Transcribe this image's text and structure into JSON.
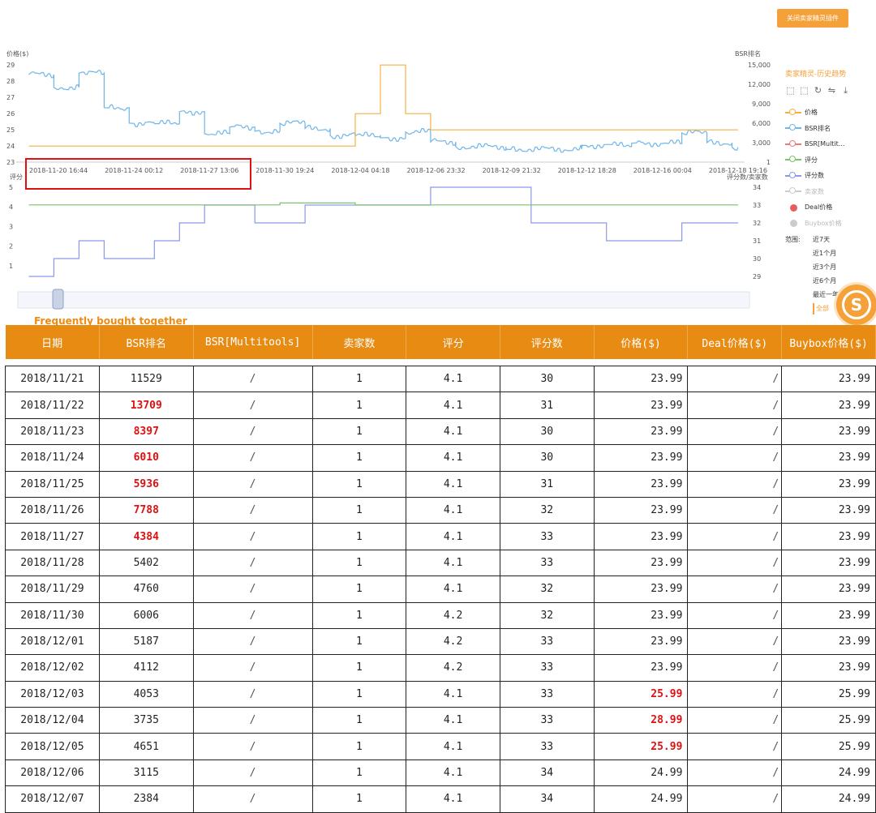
{
  "close_button": "关闭卖家精灵插件",
  "chart_data": [
    {
      "type": "line",
      "yaxis_left": {
        "label": "价格($)",
        "ticks": [
          "23",
          "24",
          "25",
          "26",
          "27",
          "28",
          "29"
        ],
        "range": [
          23,
          29
        ]
      },
      "yaxis_right": {
        "label": "BSR排名",
        "ticks": [
          "1",
          "3,000",
          "6,000",
          "9,000",
          "12,000",
          "15,000"
        ],
        "range": [
          1,
          15000
        ]
      },
      "x_ticks": [
        "2018-11-20 16:44",
        "2018-11-24 00:12",
        "2018-11-27 13:06",
        "2018-11-30 19:24",
        "2018-12-04 04:18",
        "2018-12-06 23:32",
        "2018-12-09 21:32",
        "2018-12-12 18:28",
        "2018-12-16 00:04",
        "2018-12-18 19:16"
      ],
      "series": [
        {
          "name": "价格",
          "color": "#f5b041",
          "x": [
            "2018-11-20",
            "2018-12-03",
            "2018-12-04",
            "2018-12-05",
            "2018-12-06",
            "2018-12-18"
          ],
          "values": [
            23.99,
            25.99,
            28.99,
            25.99,
            24.99,
            24.99
          ]
        },
        {
          "name": "BSR排名",
          "color": "#6fb6e8",
          "x": [
            "2018-11-20",
            "2018-11-21",
            "2018-11-22",
            "2018-11-23",
            "2018-11-24",
            "2018-11-25",
            "2018-11-26",
            "2018-11-27",
            "2018-11-28",
            "2018-11-29",
            "2018-11-30",
            "2018-12-01",
            "2018-12-02",
            "2018-12-03",
            "2018-12-04",
            "2018-12-05",
            "2018-12-06",
            "2018-12-07",
            "2018-12-09",
            "2018-12-12",
            "2018-12-14",
            "2018-12-16",
            "2018-12-17",
            "2018-12-18"
          ],
          "values": [
            13500,
            11529,
            13709,
            8397,
            6010,
            5936,
            7788,
            4384,
            5402,
            4760,
            6006,
            5187,
            4112,
            4053,
            3735,
            4651,
            3115,
            2384,
            2000,
            2600,
            2900,
            4500,
            3000,
            2300
          ]
        }
      ]
    },
    {
      "type": "line",
      "yaxis_left": {
        "label": "评分",
        "ticks": [
          "1",
          "2",
          "3",
          "4",
          "5"
        ],
        "range": [
          0,
          5
        ]
      },
      "yaxis_right": {
        "label": "评分数/卖家数",
        "ticks": [
          "29",
          "30",
          "31",
          "32",
          "33",
          "34"
        ],
        "range": [
          28.5,
          34
        ]
      },
      "series": [
        {
          "name": "评分",
          "color": "#7cc46b",
          "x": [
            "2018-11-20",
            "2018-11-30",
            "2018-12-03",
            "2018-12-18"
          ],
          "values": [
            4.1,
            4.2,
            4.1,
            4.1
          ]
        },
        {
          "name": "评分数",
          "color": "#8a9ae8",
          "x": [
            "2018-11-20",
            "2018-11-21",
            "2018-11-22",
            "2018-11-23",
            "2018-11-25",
            "2018-11-26",
            "2018-11-27",
            "2018-11-28",
            "2018-11-29",
            "2018-11-30",
            "2018-12-01",
            "2018-12-02",
            "2018-12-03",
            "2018-12-06",
            "2018-12-10",
            "2018-12-12",
            "2018-12-13",
            "2018-12-16",
            "2018-12-18"
          ],
          "values": [
            29,
            30,
            31,
            30,
            31,
            32,
            33,
            33,
            32,
            32,
            33,
            33,
            33,
            34,
            32,
            32,
            31,
            32,
            32
          ]
        }
      ]
    }
  ],
  "legend": {
    "title": "卖家精灵-历史趋势",
    "items": [
      {
        "label": "价格",
        "color": "#f5b041",
        "style": "line"
      },
      {
        "label": "BSR排名",
        "color": "#6fb6e8",
        "style": "line"
      },
      {
        "label": "BSR[Multit...",
        "color": "#e87c7c",
        "style": "line"
      },
      {
        "label": "评分",
        "color": "#7cc46b",
        "style": "line"
      },
      {
        "label": "评分数",
        "color": "#8a9ae8",
        "style": "line"
      },
      {
        "label": "卖家数",
        "color": "#cccccc",
        "style": "line"
      },
      {
        "label": "Deal价格",
        "color": "#e85c5c",
        "style": "dot"
      },
      {
        "label": "Buybox价格",
        "color": "#cccccc",
        "style": "dot"
      }
    ],
    "range_label": "范围:",
    "range_options": [
      "近7天",
      "近1个月",
      "近3个月",
      "近6个月",
      "最近一年",
      "全部"
    ]
  },
  "frequently_bought": "Frequently bought together",
  "table": {
    "headers": [
      "日期",
      "BSR排名",
      "BSR[Multitools]",
      "卖家数",
      "评分",
      "评分数",
      "价格($)",
      "Deal价格($)",
      "Buybox价格($)"
    ],
    "rows": [
      {
        "date": "2018/11/21",
        "bsr": "11529",
        "multi": "/",
        "sellers": "1",
        "rating": "4.1",
        "reviews": "30",
        "price": "23.99",
        "deal": "/",
        "buybox": "23.99"
      },
      {
        "date": "2018/11/22",
        "bsr": "13709",
        "multi": "/",
        "sellers": "1",
        "rating": "4.1",
        "reviews": "31",
        "price": "23.99",
        "deal": "/",
        "buybox": "23.99"
      },
      {
        "date": "2018/11/23",
        "bsr": "8397",
        "multi": "/",
        "sellers": "1",
        "rating": "4.1",
        "reviews": "30",
        "price": "23.99",
        "deal": "/",
        "buybox": "23.99"
      },
      {
        "date": "2018/11/24",
        "bsr": "6010",
        "multi": "/",
        "sellers": "1",
        "rating": "4.1",
        "reviews": "30",
        "price": "23.99",
        "deal": "/",
        "buybox": "23.99"
      },
      {
        "date": "2018/11/25",
        "bsr": "5936",
        "multi": "/",
        "sellers": "1",
        "rating": "4.1",
        "reviews": "31",
        "price": "23.99",
        "deal": "/",
        "buybox": "23.99"
      },
      {
        "date": "2018/11/26",
        "bsr": "7788",
        "multi": "/",
        "sellers": "1",
        "rating": "4.1",
        "reviews": "32",
        "price": "23.99",
        "deal": "/",
        "buybox": "23.99"
      },
      {
        "date": "2018/11/27",
        "bsr": "4384",
        "multi": "/",
        "sellers": "1",
        "rating": "4.1",
        "reviews": "33",
        "price": "23.99",
        "deal": "/",
        "buybox": "23.99"
      },
      {
        "date": "2018/11/28",
        "bsr": "5402",
        "multi": "/",
        "sellers": "1",
        "rating": "4.1",
        "reviews": "33",
        "price": "23.99",
        "deal": "/",
        "buybox": "23.99"
      },
      {
        "date": "2018/11/29",
        "bsr": "4760",
        "multi": "/",
        "sellers": "1",
        "rating": "4.1",
        "reviews": "32",
        "price": "23.99",
        "deal": "/",
        "buybox": "23.99"
      },
      {
        "date": "2018/11/30",
        "bsr": "6006",
        "multi": "/",
        "sellers": "1",
        "rating": "4.2",
        "reviews": "32",
        "price": "23.99",
        "deal": "/",
        "buybox": "23.99"
      },
      {
        "date": "2018/12/01",
        "bsr": "5187",
        "multi": "/",
        "sellers": "1",
        "rating": "4.2",
        "reviews": "33",
        "price": "23.99",
        "deal": "/",
        "buybox": "23.99"
      },
      {
        "date": "2018/12/02",
        "bsr": "4112",
        "multi": "/",
        "sellers": "1",
        "rating": "4.2",
        "reviews": "33",
        "price": "23.99",
        "deal": "/",
        "buybox": "23.99"
      },
      {
        "date": "2018/12/03",
        "bsr": "4053",
        "multi": "/",
        "sellers": "1",
        "rating": "4.1",
        "reviews": "33",
        "price": "25.99",
        "deal": "/",
        "buybox": "25.99"
      },
      {
        "date": "2018/12/04",
        "bsr": "3735",
        "multi": "/",
        "sellers": "1",
        "rating": "4.1",
        "reviews": "33",
        "price": "28.99",
        "deal": "/",
        "buybox": "25.99"
      },
      {
        "date": "2018/12/05",
        "bsr": "4651",
        "multi": "/",
        "sellers": "1",
        "rating": "4.1",
        "reviews": "33",
        "price": "25.99",
        "deal": "/",
        "buybox": "25.99"
      },
      {
        "date": "2018/12/06",
        "bsr": "3115",
        "multi": "/",
        "sellers": "1",
        "rating": "4.1",
        "reviews": "34",
        "price": "24.99",
        "deal": "/",
        "buybox": "24.99"
      },
      {
        "date": "2018/12/07",
        "bsr": "2384",
        "multi": "/",
        "sellers": "1",
        "rating": "4.1",
        "reviews": "34",
        "price": "24.99",
        "deal": "/",
        "buybox": "24.99"
      }
    ],
    "highlight_bsr_rows": [
      1,
      2,
      3,
      4,
      5,
      6
    ],
    "highlight_price_rows": [
      12,
      13,
      14
    ],
    "highlight_color": "#e01010"
  }
}
